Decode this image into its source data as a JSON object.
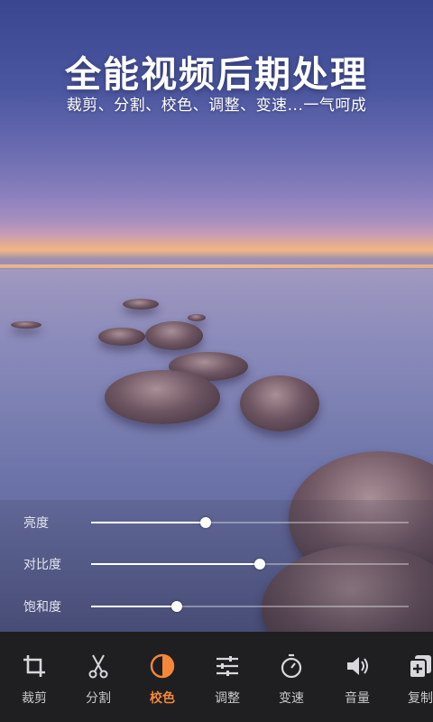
{
  "hero": {
    "title": "全能视频后期处理",
    "subtitle": "裁剪、分割、校色、调整、变速...一气呵成"
  },
  "adjustments": [
    {
      "label": "亮度",
      "value": 0.36
    },
    {
      "label": "对比度",
      "value": 0.53
    },
    {
      "label": "饱和度",
      "value": 0.27
    }
  ],
  "toolbar": {
    "active_color": "#f5873a",
    "items": [
      {
        "label": "裁剪",
        "icon": "crop-icon"
      },
      {
        "label": "分割",
        "icon": "scissors-icon"
      },
      {
        "label": "校色",
        "icon": "color-correct-icon",
        "active": true
      },
      {
        "label": "调整",
        "icon": "sliders-icon"
      },
      {
        "label": "变速",
        "icon": "stopwatch-icon"
      },
      {
        "label": "音量",
        "icon": "volume-icon"
      },
      {
        "label": "复制",
        "icon": "copy-icon"
      }
    ]
  }
}
